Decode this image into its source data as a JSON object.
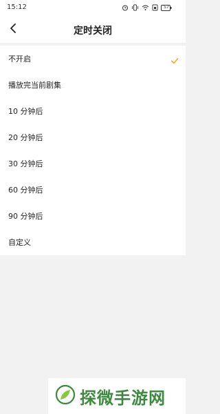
{
  "status_bar": {
    "time": "15:12",
    "battery": "57",
    "icons": [
      "alarm-icon",
      "vibrate-icon",
      "wifi-icon",
      "sim-icon",
      "battery-icon"
    ]
  },
  "nav": {
    "back_icon": "chevron-left-icon",
    "title": "定时关闭"
  },
  "options": [
    {
      "label": "不开启",
      "selected": true
    },
    {
      "label": "播放完当前剧集",
      "selected": false
    },
    {
      "label": "10 分钟后",
      "selected": false
    },
    {
      "label": "20 分钟后",
      "selected": false
    },
    {
      "label": "30 分钟后",
      "selected": false
    },
    {
      "label": "60 分钟后",
      "selected": false
    },
    {
      "label": "90 分钟后",
      "selected": false
    },
    {
      "label": "自定义",
      "selected": false
    }
  ],
  "watermark": {
    "text": "探微手游网"
  },
  "colors": {
    "accent_check": "#f5a623",
    "watermark_green": "#3d8a3e",
    "page_bg": "#f2f2f2"
  }
}
